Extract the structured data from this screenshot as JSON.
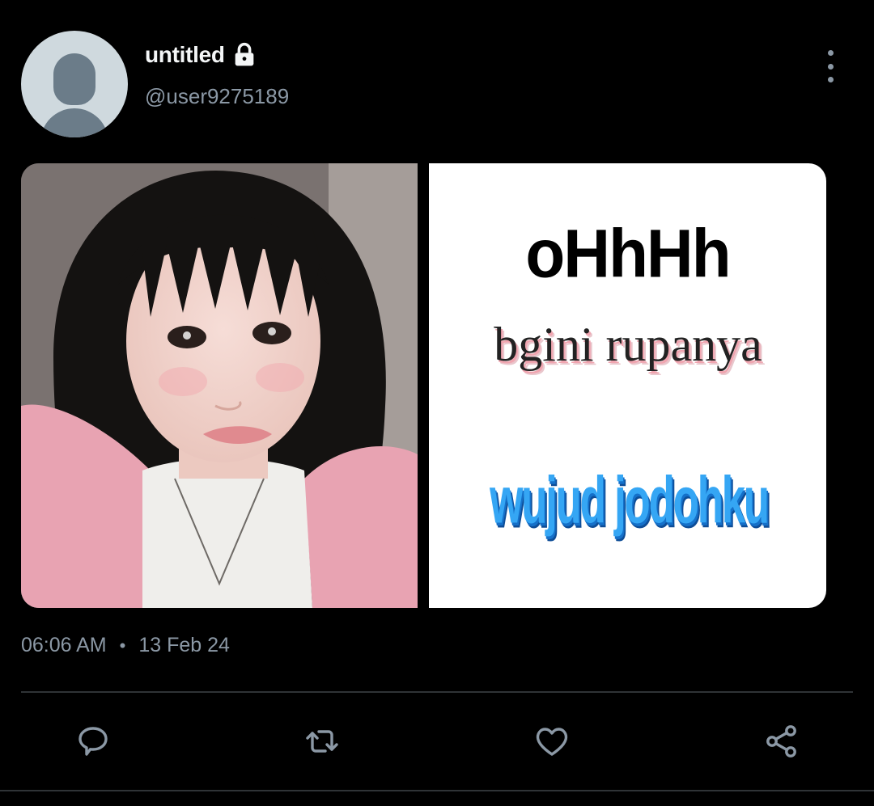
{
  "author": {
    "display_name": "untitled",
    "handle": "@user9275189",
    "protected_icon": "lock-icon",
    "avatar_icon": "default-avatar"
  },
  "menu_icon": "more-vertical-icon",
  "media": {
    "photo_icon": "photo-portrait",
    "meme": {
      "line1": "oHhHh",
      "line2": "bgini rupanya",
      "line3": "wujud jodohku"
    }
  },
  "meta": {
    "time": "06:06 AM",
    "separator": "•",
    "date": "13 Feb 24"
  },
  "actions": [
    {
      "icon": "reply-icon"
    },
    {
      "icon": "retweet-icon"
    },
    {
      "icon": "like-icon"
    },
    {
      "icon": "share-icon"
    }
  ],
  "colors": {
    "background": "#000000",
    "text_primary": "#f4f6f7",
    "text_secondary": "#8b98a5",
    "divider": "#2f3336"
  }
}
